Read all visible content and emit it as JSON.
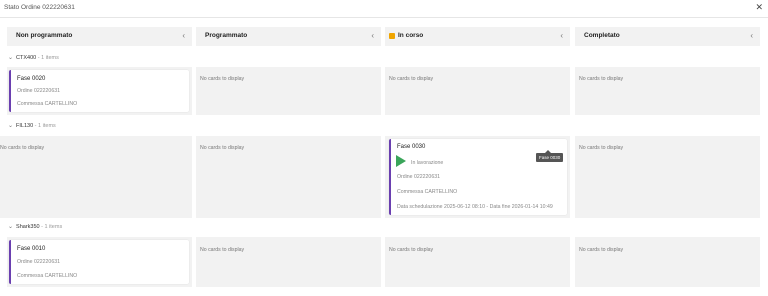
{
  "window": {
    "title": "Stato Ordine 022220631",
    "close_icon": "close-icon"
  },
  "columns": [
    {
      "label": "Non programmato"
    },
    {
      "label": "Programmato"
    },
    {
      "label": "In corso",
      "status_color": "#f0a500"
    },
    {
      "label": "Completato"
    }
  ],
  "empty_text": "No cards to display",
  "groups": [
    {
      "name": "CTX400",
      "count": " - 1 items",
      "card": {
        "title": "Fase 0020",
        "ordine": "Ordine 022220631",
        "commessa": "Commessa CARTELLINO"
      }
    },
    {
      "name": "FIL130",
      "count": " - 1 items",
      "card": {
        "title": "Fase 0030",
        "status": "In lavorazione",
        "tooltip": "Fase 0030",
        "ordine": "Ordine 022220631",
        "commessa": "Commessa CARTELLINO",
        "schedule": "Data schedulazione 2025-06-12 08:10 - Data fine 2026-01-14 10:49"
      }
    },
    {
      "name": "Shark350",
      "count": " - 1 items",
      "card": {
        "title": "Fase 0010",
        "ordine": "Ordine 022220631",
        "commessa": "Commessa CARTELLINO"
      }
    }
  ],
  "colors": {
    "card_accent": "#6a3fb0",
    "play": "#3aa55a",
    "in_corso": "#f0a500",
    "cell_bg": "#f2f2f2"
  }
}
